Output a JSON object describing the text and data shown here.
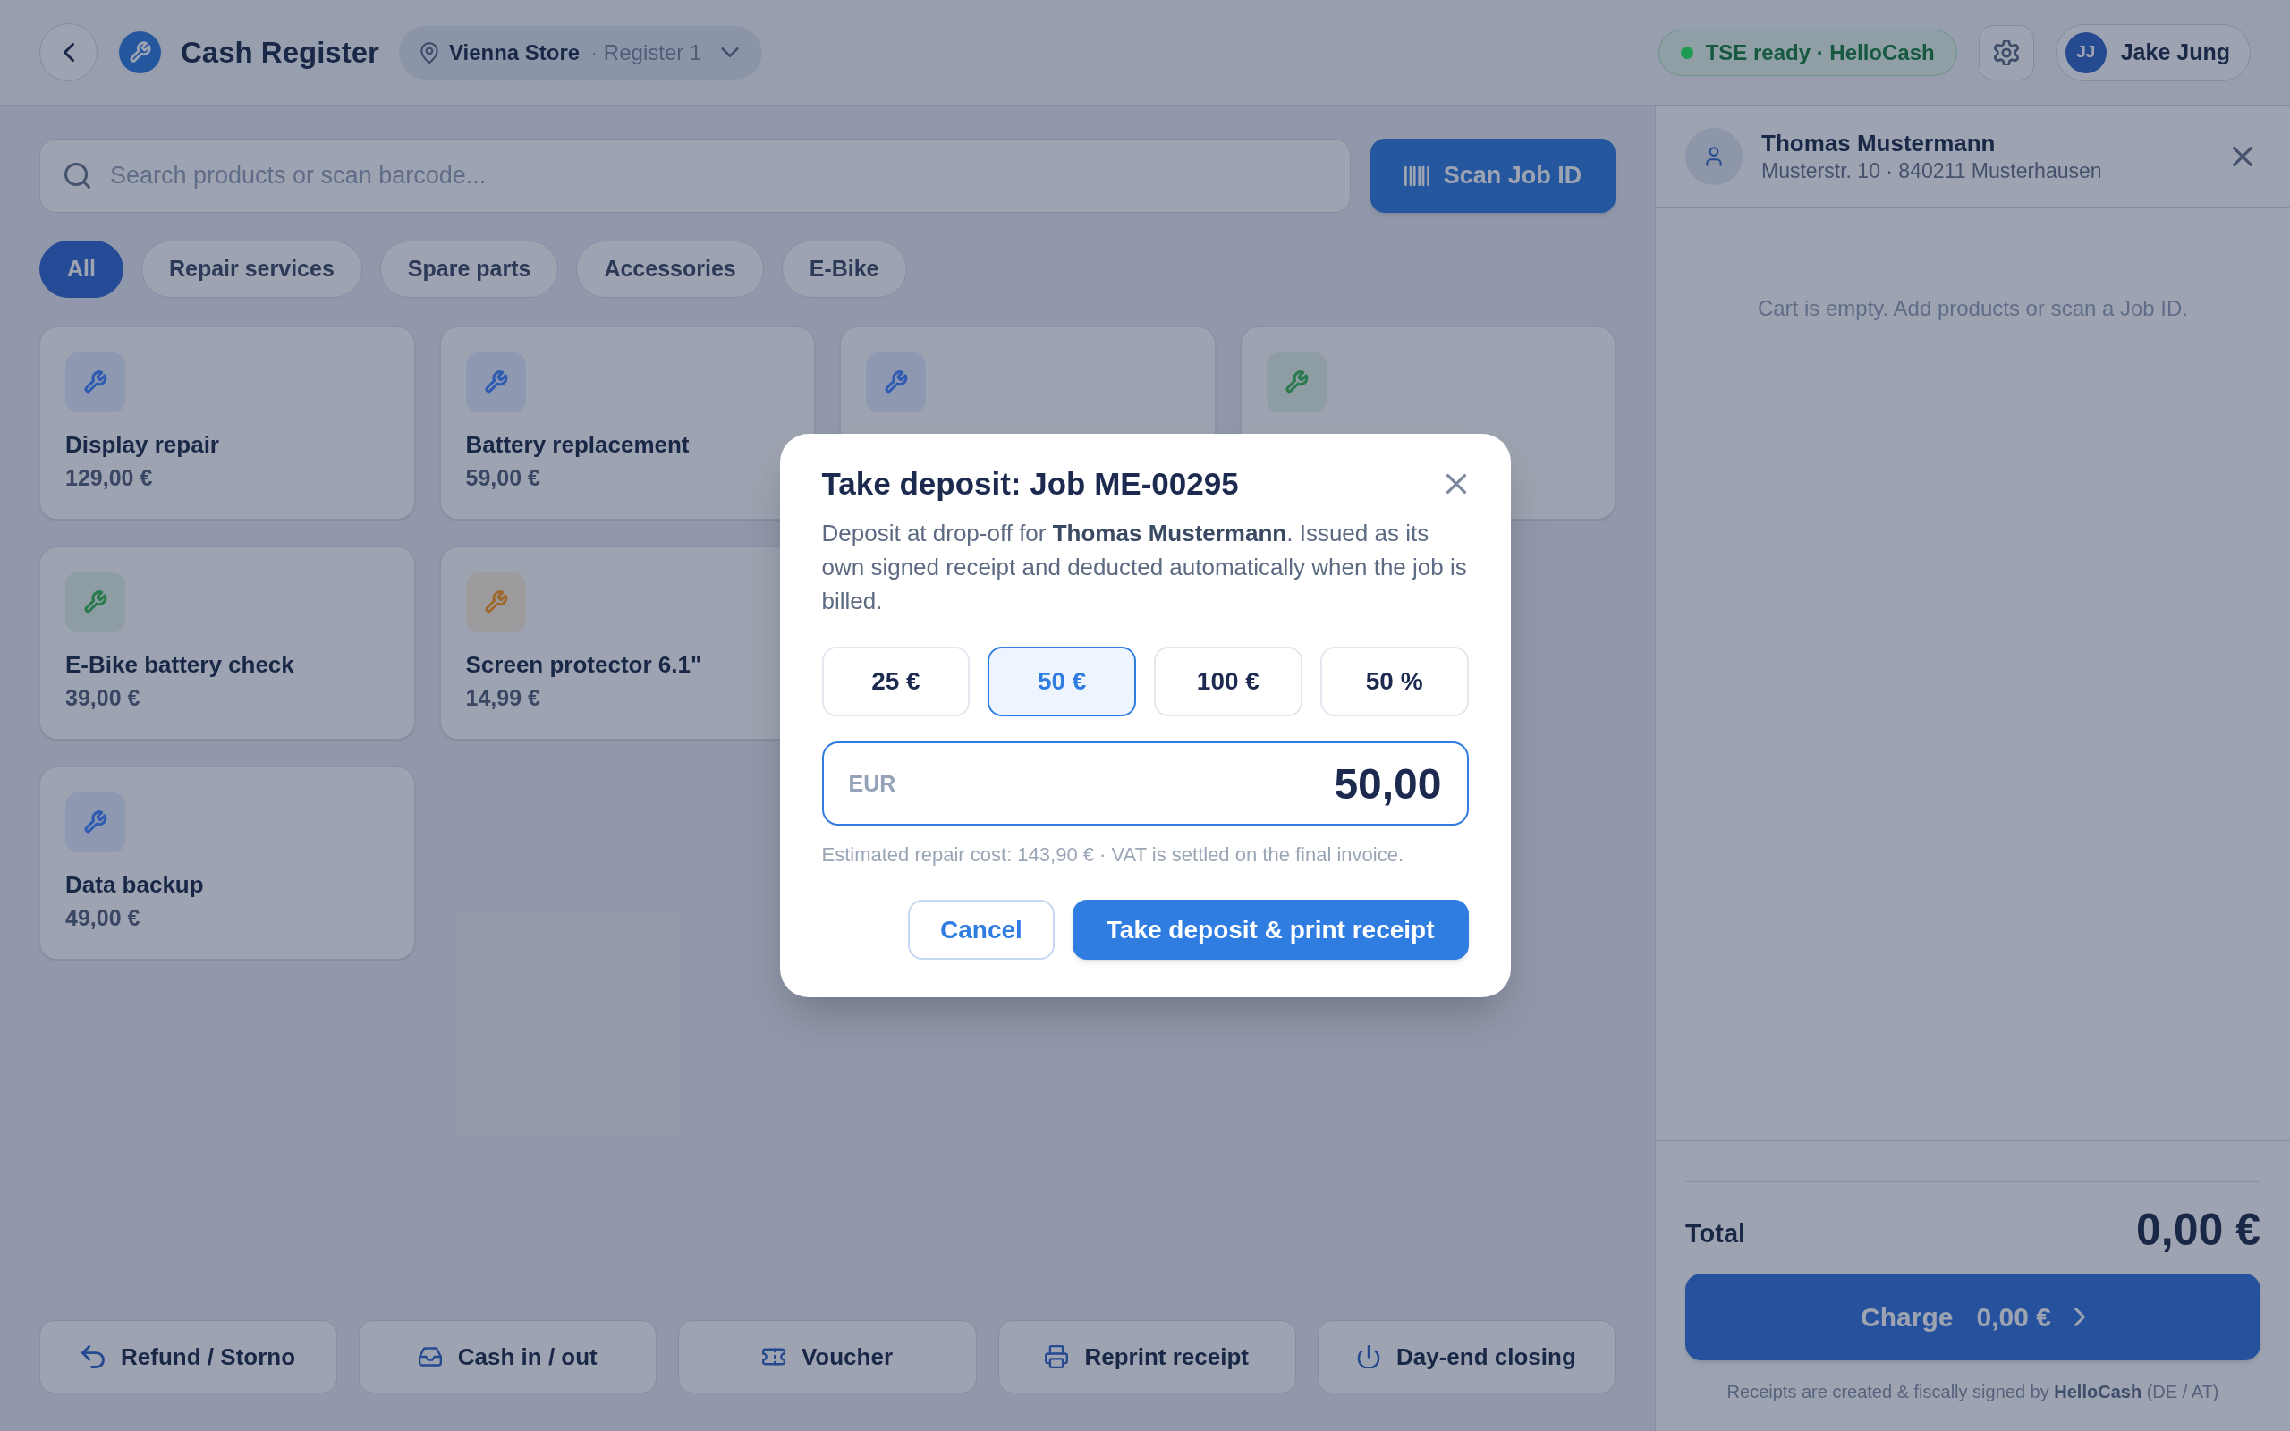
{
  "header": {
    "title": "Cash Register",
    "location": {
      "store": "Vienna Store",
      "register": "· Register 1"
    },
    "tse_status": {
      "label": "TSE ready · HelloCash",
      "color": "#1f9a52"
    },
    "user": {
      "initials": "JJ",
      "name": "Jake Jung"
    }
  },
  "search": {
    "placeholder": "Search products or scan barcode..."
  },
  "scan_button": {
    "label": "Scan Job ID"
  },
  "filters": [
    {
      "label": "All",
      "selected": true
    },
    {
      "label": "Repair services",
      "selected": false
    },
    {
      "label": "Spare parts",
      "selected": false
    },
    {
      "label": "Accessories",
      "selected": false
    },
    {
      "label": "E-Bike",
      "selected": false
    }
  ],
  "product_rows": [
    [
      {
        "name": "Display repair",
        "price": "129,00 €",
        "color": "#2f5bb0"
      },
      {
        "name": "Battery replacement",
        "price": "59,00 €",
        "color": "#2f5bb0"
      },
      {
        "color": "#2f5bb0"
      },
      {
        "color": "#2a7a4e"
      }
    ],
    [
      {
        "name": "E-Bike battery check",
        "price": "39,00 €",
        "color": "#2a7a4e"
      },
      {
        "name": "Screen protector 6.1\"",
        "price": "14,99 €",
        "color": "#9c6a30"
      }
    ],
    [
      {
        "name": "Data backup",
        "price": "49,00 €",
        "color": "#2f5bb0"
      }
    ]
  ],
  "actions": [
    {
      "label": "Refund / Storno"
    },
    {
      "label": "Cash in / out"
    },
    {
      "label": "Voucher"
    },
    {
      "label": "Reprint receipt"
    },
    {
      "label": "Day-end closing"
    }
  ],
  "customer": {
    "name": "Thomas Mustermann",
    "address": "Musterstr. 10 · 840211 Musterhausen"
  },
  "cart": {
    "empty_message": "Cart is empty. Add products or scan a Job ID."
  },
  "total": {
    "label": "Total",
    "value": "0,00 €"
  },
  "charge_button": {
    "label": "Charge",
    "amount": "0,00 €"
  },
  "footer_note": "Receipts are created & fiscally signed by **HelloCash** (DE / AT)",
  "dialog": {
    "title": "Take deposit: Job ME-00295",
    "description": "Deposit at drop-off for **Thomas Mustermann**. Issued as its own signed receipt and deducted automatically when the job is billed.",
    "presets": [
      {
        "label": "25 €",
        "selected": false
      },
      {
        "label": "50 €",
        "selected": true
      },
      {
        "label": "100 €",
        "selected": false
      },
      {
        "label": "50 %",
        "selected": false
      }
    ],
    "amount_field": {
      "currency": "EUR",
      "value": "50,00"
    },
    "hint": "Estimated repair cost: 143,90 € · VAT is settled on the final invoice.",
    "buttons": [
      {
        "label": "Cancel",
        "kind": "secondary"
      },
      {
        "label": "Take deposit & print receipt",
        "kind": "primary"
      }
    ]
  }
}
